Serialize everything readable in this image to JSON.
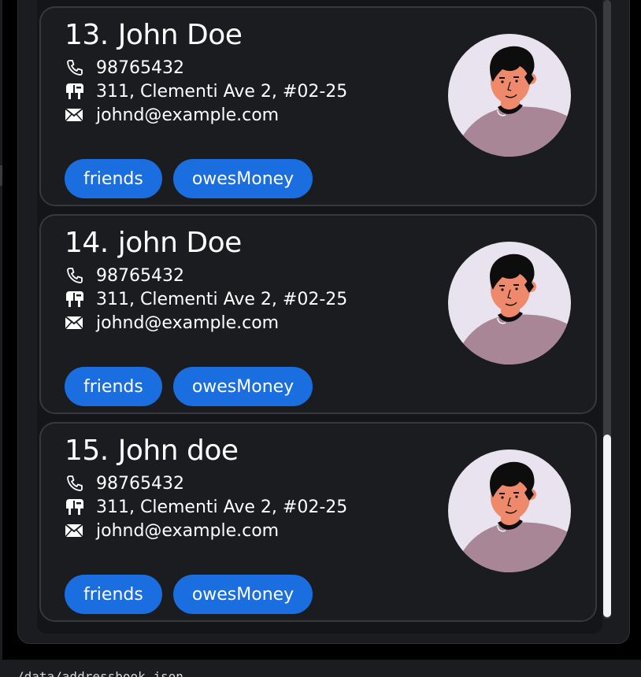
{
  "colors": {
    "background": "#000000",
    "panel": "#1b1c1f",
    "card_border": "#37383c",
    "tag": "#1a6ee0",
    "text": "#ffffff",
    "scrollbar_thumb": "#f2f2f4"
  },
  "persons": [
    {
      "index": "13.",
      "name": "John Doe",
      "phone": "98765432",
      "address": "311, Clementi Ave 2, #02-25",
      "email": "johnd@example.com",
      "tags": [
        "friends",
        "owesMoney"
      ],
      "icons": {
        "phone": "phone-icon",
        "address": "mailbox-icon",
        "email": "envelope-icon"
      }
    },
    {
      "index": "14.",
      "name": "john Doe",
      "phone": "98765432",
      "address": "311, Clementi Ave 2, #02-25",
      "email": "johnd@example.com",
      "tags": [
        "friends",
        "owesMoney"
      ],
      "icons": {
        "phone": "phone-icon",
        "address": "mailbox-icon",
        "email": "envelope-icon"
      }
    },
    {
      "index": "15.",
      "name": "John doe",
      "phone": "98765432",
      "address": "311, Clementi Ave 2, #02-25",
      "email": "johnd@example.com",
      "tags": [
        "friends",
        "owesMoney"
      ],
      "icons": {
        "phone": "phone-icon",
        "address": "mailbox-icon",
        "email": "envelope-icon"
      }
    }
  ],
  "status_bar": {
    "path": "/data/addressbook.json"
  }
}
